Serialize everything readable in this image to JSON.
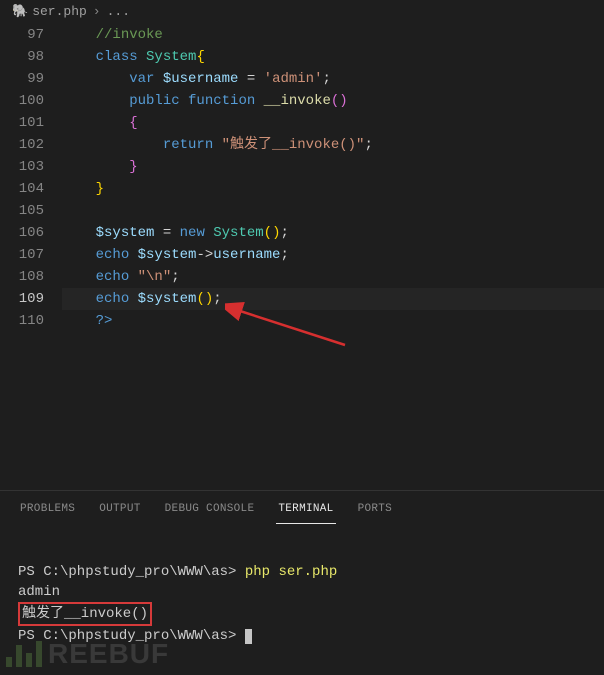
{
  "breadcrumb": {
    "icon": "🐘",
    "file": "ser.php",
    "sep": "›",
    "dots": "..."
  },
  "lines": [
    {
      "n": 97,
      "tokens": [
        [
          "    ",
          "p"
        ],
        [
          "//invoke",
          "comment"
        ]
      ]
    },
    {
      "n": 98,
      "tokens": [
        [
          "    ",
          "p"
        ],
        [
          "class ",
          "keyword"
        ],
        [
          "System",
          "class"
        ],
        [
          "{",
          "brace-y"
        ]
      ]
    },
    {
      "n": 99,
      "tokens": [
        [
          "        ",
          "p"
        ],
        [
          "var ",
          "keyword"
        ],
        [
          "$username",
          "var"
        ],
        [
          " = ",
          "p"
        ],
        [
          "'admin'",
          "string"
        ],
        [
          ";",
          "p"
        ]
      ]
    },
    {
      "n": 100,
      "tokens": [
        [
          "        ",
          "p"
        ],
        [
          "public ",
          "keyword"
        ],
        [
          "function ",
          "keyword"
        ],
        [
          "__invoke",
          "func"
        ],
        [
          "()",
          "brace-p"
        ]
      ]
    },
    {
      "n": 101,
      "tokens": [
        [
          "        ",
          "p"
        ],
        [
          "{",
          "brace-p"
        ]
      ]
    },
    {
      "n": 102,
      "tokens": [
        [
          "            ",
          "p"
        ],
        [
          "return ",
          "keyword"
        ],
        [
          "\"触发了__invoke()\"",
          "string"
        ],
        [
          ";",
          "p"
        ]
      ]
    },
    {
      "n": 103,
      "tokens": [
        [
          "        ",
          "p"
        ],
        [
          "}",
          "brace-p"
        ]
      ]
    },
    {
      "n": 104,
      "tokens": [
        [
          "    ",
          "p"
        ],
        [
          "}",
          "brace-y"
        ]
      ]
    },
    {
      "n": 105,
      "tokens": [
        [
          "",
          "p"
        ]
      ]
    },
    {
      "n": 106,
      "tokens": [
        [
          "    ",
          "p"
        ],
        [
          "$system",
          "var"
        ],
        [
          " = ",
          "p"
        ],
        [
          "new ",
          "keyword"
        ],
        [
          "System",
          "class"
        ],
        [
          "()",
          "brace-y"
        ],
        [
          ";",
          "p"
        ]
      ]
    },
    {
      "n": 107,
      "tokens": [
        [
          "    ",
          "p"
        ],
        [
          "echo ",
          "keyword"
        ],
        [
          "$system",
          "var"
        ],
        [
          "->",
          "p"
        ],
        [
          "username",
          "var"
        ],
        [
          ";",
          "p"
        ]
      ]
    },
    {
      "n": 108,
      "tokens": [
        [
          "    ",
          "p"
        ],
        [
          "echo ",
          "keyword"
        ],
        [
          "\"\\n\"",
          "string"
        ],
        [
          ";",
          "p"
        ]
      ]
    },
    {
      "n": 109,
      "active": true,
      "tokens": [
        [
          "    ",
          "p"
        ],
        [
          "echo ",
          "keyword"
        ],
        [
          "$system",
          "var"
        ],
        [
          "()",
          "brace-y"
        ],
        [
          ";",
          "p"
        ]
      ]
    },
    {
      "n": 110,
      "tokens": [
        [
          "    ",
          "p"
        ],
        [
          "?>",
          "keyword"
        ]
      ]
    }
  ],
  "panel": {
    "tabs": [
      {
        "label": "PROBLEMS",
        "active": false
      },
      {
        "label": "OUTPUT",
        "active": false
      },
      {
        "label": "DEBUG CONSOLE",
        "active": false
      },
      {
        "label": "TERMINAL",
        "active": true
      },
      {
        "label": "PORTS",
        "active": false
      }
    ]
  },
  "terminal": {
    "prompt1_prefix": "PS C:\\phpstudy_pro\\WWW\\as> ",
    "prompt1_cmd": "php ser.php",
    "out_line1": "admin",
    "out_line2": "触发了__invoke()",
    "prompt2_prefix": "PS C:\\phpstudy_pro\\WWW\\as> "
  },
  "watermark": "REEBUF"
}
